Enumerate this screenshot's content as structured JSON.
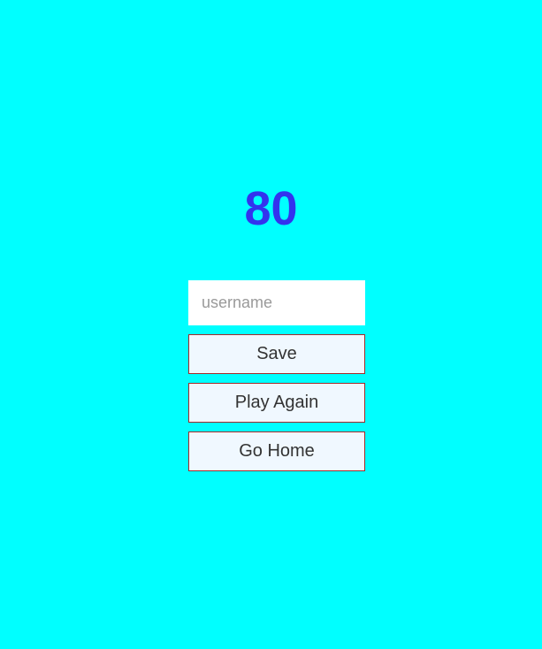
{
  "score": {
    "value": "80",
    "color": "#3333EE"
  },
  "form": {
    "username_placeholder": "username",
    "username_value": "",
    "save_label": "Save",
    "play_again_label": "Play Again",
    "go_home_label": "Go Home"
  },
  "colors": {
    "background": "#00FFFF",
    "button_bg": "#F0F8FF",
    "button_border": "#A52A2A"
  }
}
